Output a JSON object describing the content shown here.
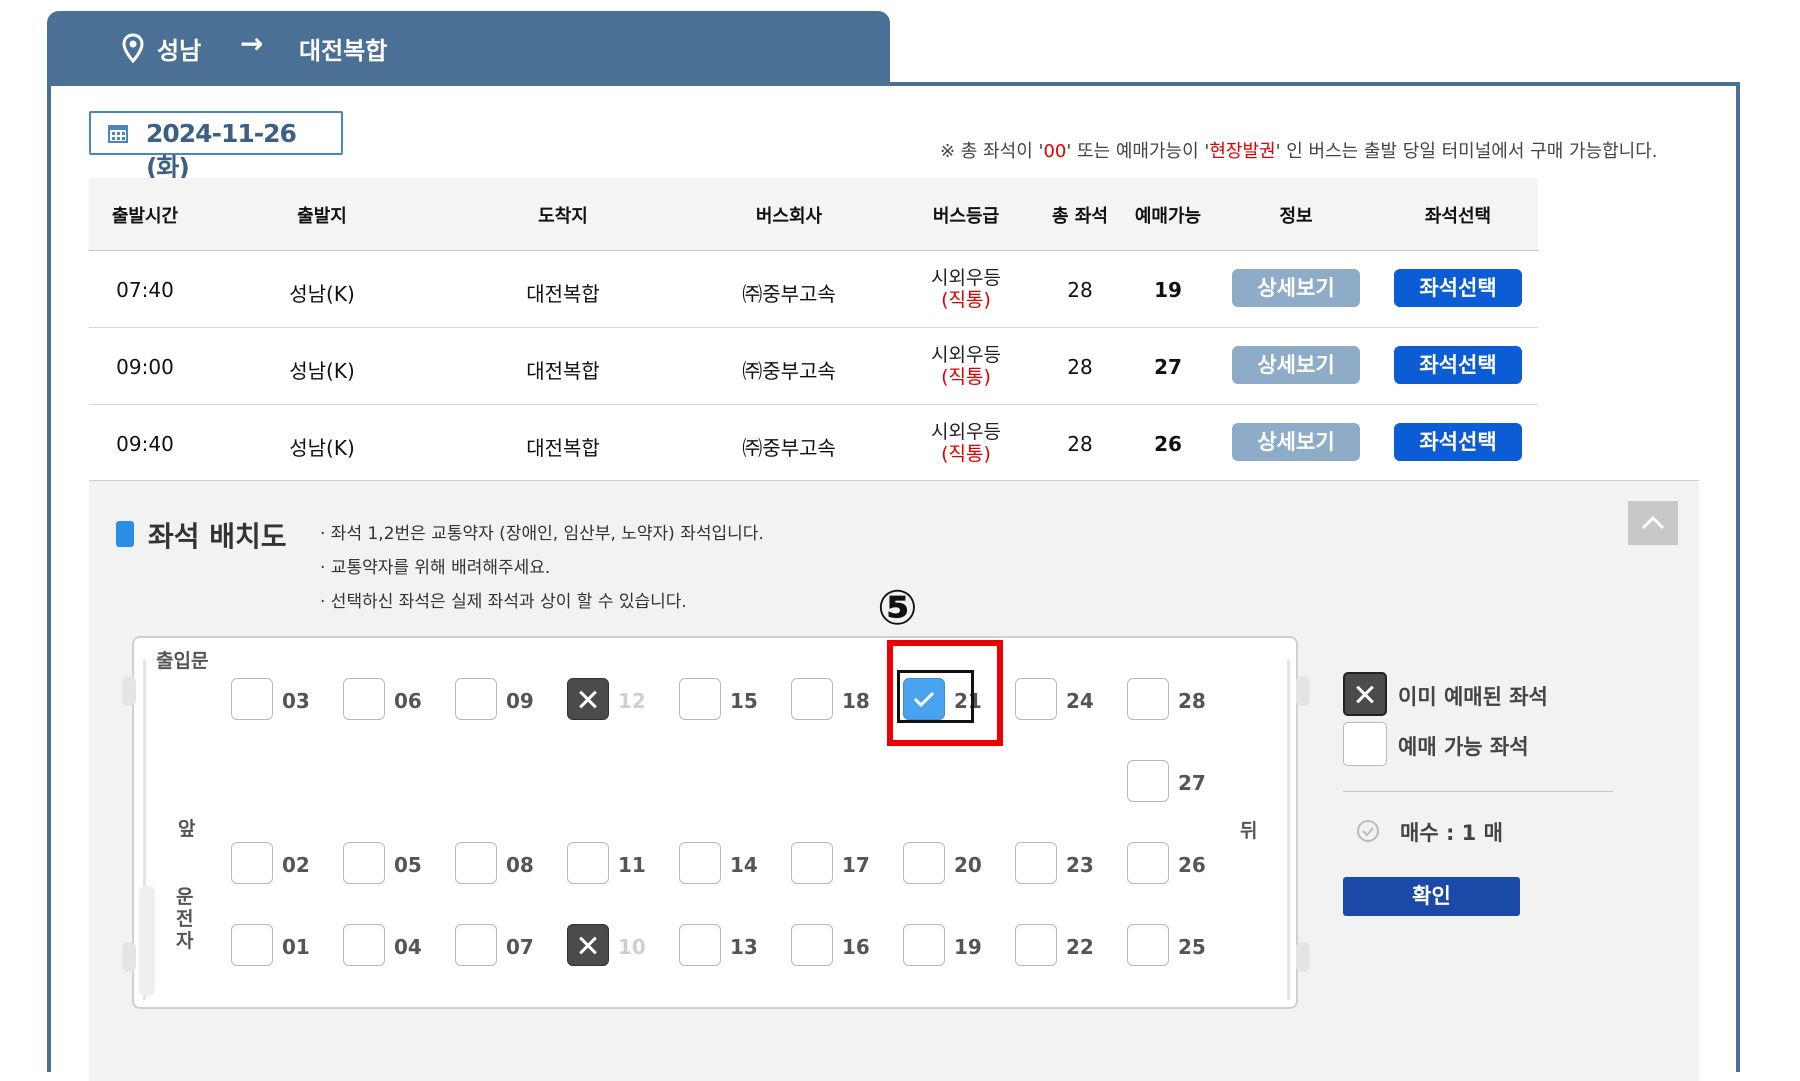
{
  "route": {
    "from": "성남",
    "arrow": "→",
    "to": "대전복합"
  },
  "date": "2024-11-26 (화)",
  "notice": {
    "pre": "※ 총 좌석이 '",
    "zero": "00",
    "mid": "' 또는 예매가능이 '",
    "onsite": "현장발권",
    "post": "' 인 버스는 출발 당일 터미널에서 구매 가능합니다."
  },
  "table": {
    "headers": [
      "출발시간",
      "출발지",
      "도착지",
      "버스회사",
      "버스등급",
      "총 좌석",
      "예매가능",
      "정보",
      "좌석선택"
    ],
    "rows": [
      {
        "time": "07:40",
        "from": "성남(K)",
        "to": "대전복합",
        "company": "㈜중부고속",
        "grade": "시외우등",
        "grade_sub": "(직통)",
        "total": "28",
        "available": "19",
        "detail": "상세보기",
        "select": "좌석선택"
      },
      {
        "time": "09:00",
        "from": "성남(K)",
        "to": "대전복합",
        "company": "㈜중부고속",
        "grade": "시외우등",
        "grade_sub": "(직통)",
        "total": "28",
        "available": "27",
        "detail": "상세보기",
        "select": "좌석선택"
      },
      {
        "time": "09:40",
        "from": "성남(K)",
        "to": "대전복합",
        "company": "㈜중부고속",
        "grade": "시외우등",
        "grade_sub": "(직통)",
        "total": "28",
        "available": "26",
        "detail": "상세보기",
        "select": "좌석선택"
      }
    ]
  },
  "seatmap": {
    "title": "좌석 배치도",
    "notes": [
      "· 좌석 1,2번은 교통약자 (장애인, 임산부, 노약자) 좌석입니다.",
      "· 교통약자를 위해 배려해주세요.",
      "· 선택하신 좌석은 실제 좌석과 상이 할 수 있습니다."
    ],
    "labels": {
      "entrance": "출입문",
      "front": "앞",
      "driver": "운\n전\n자",
      "back": "뒤"
    },
    "seats": {
      "s03": "03",
      "s06": "06",
      "s09": "09",
      "s12": "12",
      "s15": "15",
      "s18": "18",
      "s21": "21",
      "s24": "24",
      "s28": "28",
      "s27": "27",
      "s02": "02",
      "s05": "05",
      "s08": "08",
      "s11": "11",
      "s14": "14",
      "s17": "17",
      "s20": "20",
      "s23": "23",
      "s26": "26",
      "s01": "01",
      "s04": "04",
      "s07": "07",
      "s10": "10",
      "s13": "13",
      "s16": "16",
      "s19": "19",
      "s22": "22",
      "s25": "25"
    },
    "booked": [
      "12",
      "10"
    ],
    "selected": [
      "21"
    ]
  },
  "legend": {
    "booked": "이미 예매된 좌석",
    "available": "예매 가능 좌석",
    "count": "매수 : 1 매",
    "confirm": "확인"
  },
  "annotation": {
    "step": "⑤"
  },
  "colors": {
    "header_blue": "#4a7096",
    "select_blue": "#0b5cd5",
    "detail_gray": "#8eabc7",
    "confirm_blue": "#1a49a8",
    "highlight_red": "#ee0000"
  }
}
